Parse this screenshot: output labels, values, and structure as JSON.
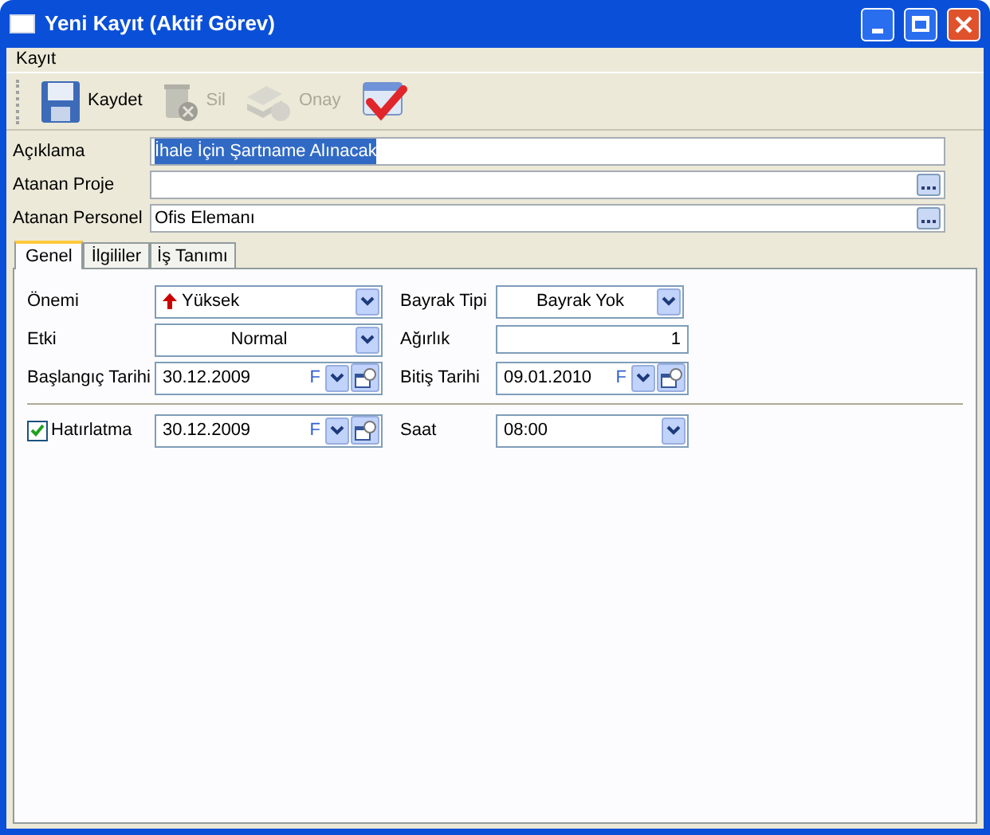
{
  "window": {
    "title": "Yeni Kayıt (Aktif Görev)"
  },
  "menu": [
    "Kayıt"
  ],
  "toolbar": [
    {
      "kind": "save",
      "label": "Kaydet",
      "disabled": false
    },
    {
      "kind": "delete",
      "label": "Sil",
      "disabled": true
    },
    {
      "kind": "approve",
      "label": "Onay",
      "disabled": true
    },
    {
      "kind": "check"
    }
  ],
  "fields": [
    {
      "label": "Açıklama",
      "value": "İhale İçin Şartname Alınacak",
      "selected": true,
      "lookup": false
    },
    {
      "label": "Atanan Proje",
      "lookup": true
    },
    {
      "label": "Atanan Personel",
      "value": "Ofis Elemanı",
      "selected": false,
      "lookup": true
    }
  ],
  "tabs": [
    {
      "label": "Genel",
      "selected": true
    },
    {
      "label": "İlgililer",
      "selected": false
    },
    {
      "label": "İş Tanımı",
      "selected": false
    }
  ],
  "rows": [
    {
      "kind": "fields",
      "cells": [
        {
          "kind": "priority_combo",
          "label": "Önemi",
          "value": "Yüksek"
        },
        {
          "kind": "center_combo",
          "label": "Bayrak Tipi",
          "value": "Bayrak Yok"
        }
      ]
    },
    {
      "kind": "fields",
      "cells": [
        {
          "kind": "center_combo",
          "label": "Etki",
          "value": "Normal"
        },
        {
          "kind": "number",
          "label": "Ağırlık",
          "value": "1"
        }
      ]
    },
    {
      "kind": "fields",
      "cells": [
        {
          "kind": "date",
          "label": "Başlangıç Tarihi",
          "value": "30.12.2009",
          "flag": "F"
        },
        {
          "kind": "date",
          "label": "Bitiş Tarihi",
          "value": "09.01.2010",
          "flag": "F"
        }
      ]
    },
    {
      "kind": "separator"
    },
    {
      "kind": "fields",
      "cells": [
        {
          "kind": "date",
          "label": "Hatırlatma",
          "checked": true,
          "value": "30.12.2009",
          "flag": "F"
        },
        {
          "kind": "combo",
          "label": "Saat",
          "value": "08:00"
        }
      ]
    }
  ]
}
